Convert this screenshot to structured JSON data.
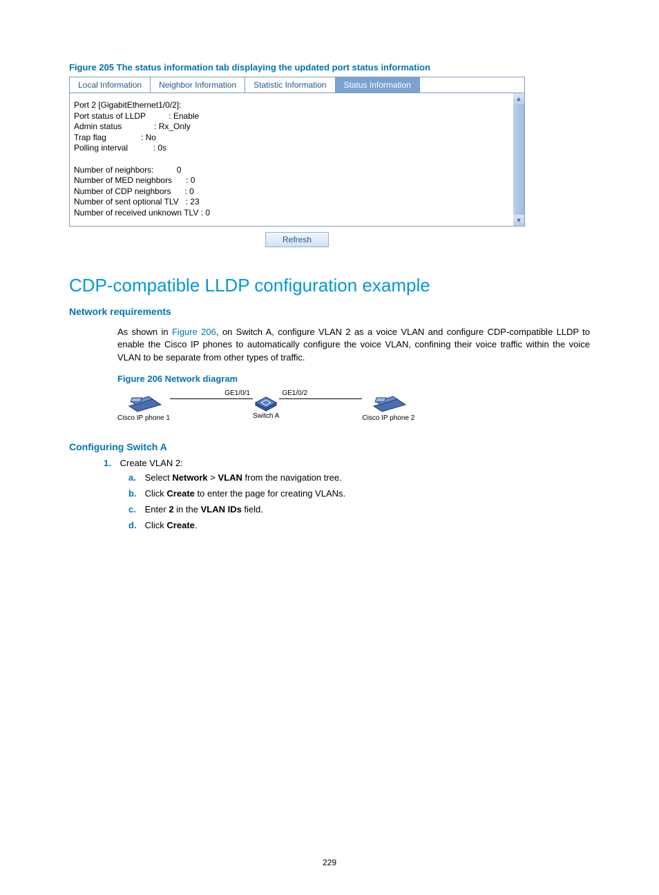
{
  "figure205": {
    "caption": "Figure 205 The status information tab displaying the updated port status information",
    "tabs": [
      "Local Information",
      "Neighbor Information",
      "Statistic Information",
      "Status Information"
    ],
    "content": "Port 2 [GigabitEthernet1/0/2]:\nPort status of LLDP          : Enable\nAdmin status              : Rx_Only\nTrap flag               : No\nPolling interval           : 0s\n\nNumber of neighbors:          0\nNumber of MED neighbors      : 0\nNumber of CDP neighbors      : 0\nNumber of sent optional TLV   : 23\nNumber of received unknown TLV : 0",
    "refresh": "Refresh"
  },
  "section_title": "CDP-compatible LLDP configuration example",
  "net_req": {
    "heading": "Network requirements",
    "text_pre": "As shown in ",
    "fig_ref": "Figure 206",
    "text_post": ", on Switch A, configure VLAN 2 as a voice VLAN and configure CDP-compatible LLDP to enable the Cisco IP phones to automatically configure the voice VLAN, confining their voice traffic within the voice VLAN to be separate from other types of traffic."
  },
  "figure206": {
    "caption": "Figure 206 Network diagram",
    "phone1": "Cisco IP phone 1",
    "switch": "Switch A",
    "phone2": "Cisco IP phone 2",
    "port1": "GE1/0/1",
    "port2": "GE1/0/2"
  },
  "config": {
    "heading": "Configuring Switch A",
    "step1_num": "1.",
    "step1_text": "Create VLAN 2:",
    "sub": {
      "a": {
        "l": "a.",
        "pre": "Select ",
        "b1": "Network",
        "mid": " > ",
        "b2": "VLAN",
        "post": " from the navigation tree."
      },
      "b": {
        "l": "b.",
        "pre": "Click ",
        "b1": "Create",
        "post": " to enter the page for creating VLANs."
      },
      "c": {
        "l": "c.",
        "pre": "Enter ",
        "b1": "2",
        "mid": " in the ",
        "b2": "VLAN IDs",
        "post": " field."
      },
      "d": {
        "l": "d.",
        "pre": "Click ",
        "b1": "Create",
        "post": "."
      }
    }
  },
  "page_number": "229"
}
